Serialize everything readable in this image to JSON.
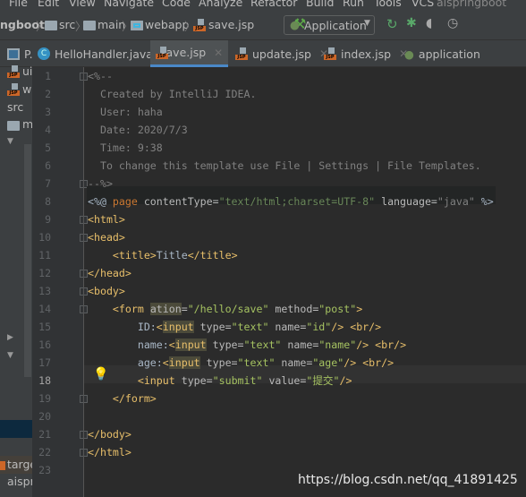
{
  "menu": [
    "File",
    "Edit",
    "View",
    "Navigate",
    "Code",
    "Analyze",
    "Refactor",
    "Build",
    "Run",
    "Tools",
    "VCS",
    "aispringboot"
  ],
  "breadcrumb": [
    "ngboot",
    "src",
    "main",
    "webapp",
    "save.jsp"
  ],
  "run_config": "Application",
  "tabs": [
    {
      "label": "P."
    },
    {
      "label": "HelloHandler.java"
    },
    {
      "label": "save.jsp",
      "active": true
    },
    {
      "label": "update.jsp"
    },
    {
      "label": "index.jsp"
    },
    {
      "label": "application"
    }
  ],
  "project_items": [
    "ui",
    "w",
    "src",
    "m",
    "targe",
    "aispr"
  ],
  "line_numbers": [
    "1",
    "2",
    "3",
    "4",
    "5",
    "6",
    "7",
    "8",
    "9",
    "10",
    "11",
    "12",
    "13",
    "14",
    "15",
    "16",
    "17",
    "18",
    "19",
    "20",
    "21",
    "22",
    "23"
  ],
  "code": [
    [
      [
        "<%--",
        "cm"
      ]
    ],
    [
      [
        "  Created by IntelliJ IDEA.",
        "cm"
      ]
    ],
    [
      [
        "  User: haha",
        "cm"
      ]
    ],
    [
      [
        "  Date: 2020/7/3",
        "cm"
      ]
    ],
    [
      [
        "  Time: 9:38",
        "cm"
      ]
    ],
    [
      [
        "  To change this template use File | Settings | File Templates.",
        "cm"
      ]
    ],
    [
      [
        "--%>",
        "cm"
      ]
    ],
    [
      [
        "<%@ ",
        "jd"
      ],
      [
        "page ",
        "kw"
      ],
      [
        "contentType=",
        "at"
      ],
      [
        "\"text/html;charset=UTF-8\"",
        "sg"
      ],
      [
        " language=",
        "at"
      ],
      [
        "\"java\"",
        "cm"
      ],
      [
        " %>",
        "jd"
      ]
    ],
    [
      [
        "<html>",
        "tg"
      ]
    ],
    [
      [
        "<head>",
        "tg"
      ]
    ],
    [
      [
        "    ",
        "tx"
      ],
      [
        "<title>",
        "tg"
      ],
      [
        "Title",
        "tx"
      ],
      [
        "</title>",
        "tg"
      ]
    ],
    [
      [
        "</head>",
        "tg"
      ]
    ],
    [
      [
        "<body>",
        "tg"
      ]
    ],
    [
      [
        "    ",
        "tx"
      ],
      [
        "<form ",
        "tg"
      ],
      [
        "ation",
        "at hl"
      ],
      [
        "=",
        "at"
      ],
      [
        "\"/hello/save\"",
        "sv"
      ],
      [
        " method=",
        "at"
      ],
      [
        "\"post\"",
        "sv"
      ],
      [
        ">",
        "tg"
      ]
    ],
    [
      [
        "        ID:",
        "tx"
      ],
      [
        "<",
        "tg"
      ],
      [
        "input",
        "tg hl"
      ],
      [
        " type=",
        "at"
      ],
      [
        "\"text\"",
        "sv"
      ],
      [
        " name=",
        "at"
      ],
      [
        "\"id\"",
        "sv"
      ],
      [
        "/>",
        "tg"
      ],
      [
        " ",
        "tx"
      ],
      [
        "<br/>",
        "tg"
      ]
    ],
    [
      [
        "        name:",
        "tx"
      ],
      [
        "<",
        "tg"
      ],
      [
        "input",
        "tg hl"
      ],
      [
        " type=",
        "at"
      ],
      [
        "\"text\"",
        "sv"
      ],
      [
        " name=",
        "at"
      ],
      [
        "\"name\"",
        "sv"
      ],
      [
        "/>",
        "tg"
      ],
      [
        " ",
        "tx"
      ],
      [
        "<br/>",
        "tg"
      ]
    ],
    [
      [
        "        age:",
        "tx"
      ],
      [
        "<",
        "tg"
      ],
      [
        "input",
        "tg hl"
      ],
      [
        " type=",
        "at"
      ],
      [
        "\"text\"",
        "sv"
      ],
      [
        " name=",
        "at"
      ],
      [
        "\"age\"",
        "sv"
      ],
      [
        "/>",
        "tg"
      ],
      [
        " ",
        "tx"
      ],
      [
        "<br/>",
        "tg"
      ]
    ],
    [
      [
        "        ",
        "tx"
      ],
      [
        "<input",
        "tg"
      ],
      [
        " type=",
        "at"
      ],
      [
        "\"submit\"",
        "sv"
      ],
      [
        " value=",
        "at"
      ],
      [
        "\"提交\"",
        "sv"
      ],
      [
        "/>",
        "tg"
      ]
    ],
    [
      [
        "    ",
        "tx"
      ],
      [
        "</form>",
        "tg"
      ]
    ],
    [],
    [
      [
        "</body>",
        "tg"
      ]
    ],
    [
      [
        "</html>",
        "tg"
      ]
    ],
    []
  ],
  "watermark": "https://blog.csdn.net/qq_41891425",
  "colors": {
    "accent": "#4a88c7",
    "tag": "#e8bf6a",
    "comment": "#808080"
  }
}
